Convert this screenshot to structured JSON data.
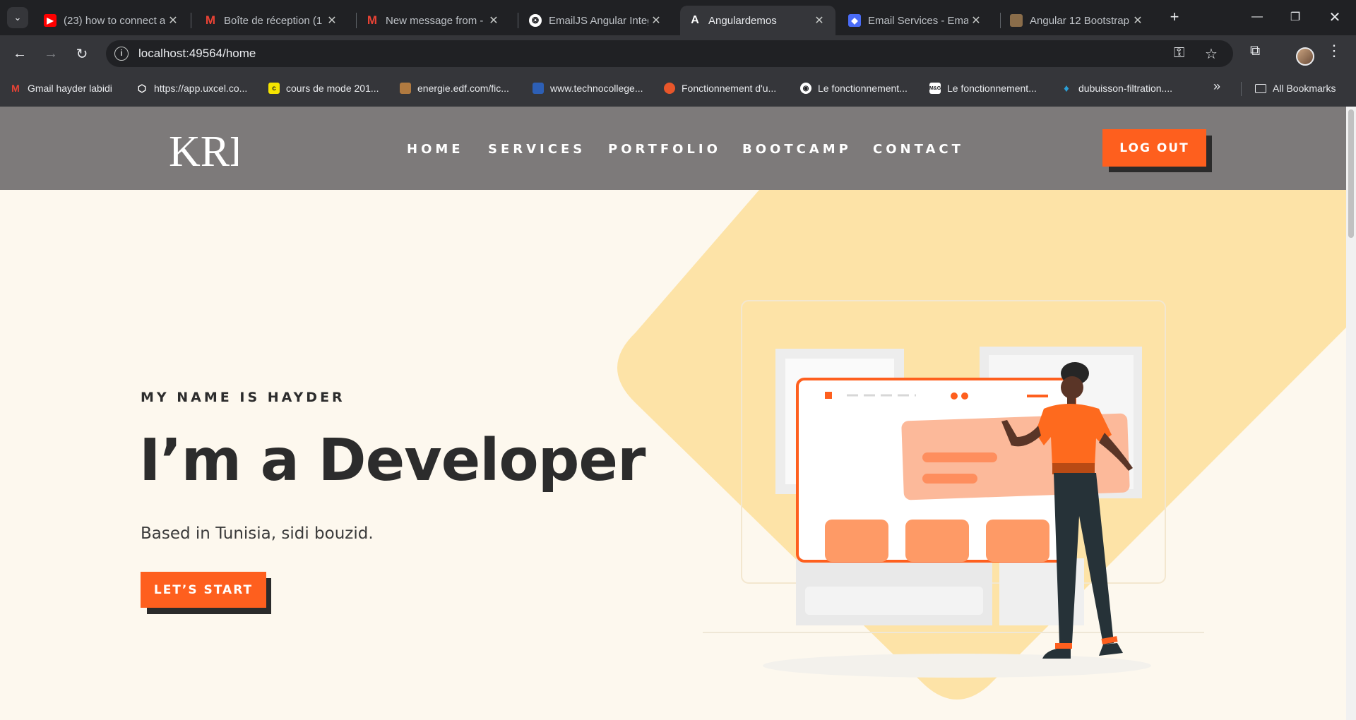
{
  "browser": {
    "tabs": [
      {
        "title": "(23) how to connect a",
        "favicon": "youtube-icon",
        "color": "#ff0000"
      },
      {
        "title": "Boîte de réception (1",
        "favicon": "gmail-icon",
        "color": "#ea4335"
      },
      {
        "title": "New message from -",
        "favicon": "gmail-icon",
        "color": "#ea4335"
      },
      {
        "title": "EmailJS Angular Integ",
        "favicon": "chatgpt-icon",
        "color": "#ffffff"
      },
      {
        "title": "Angulardemos",
        "favicon": "angular-icon",
        "color": "#ffffff",
        "active": true
      },
      {
        "title": "Email Services - Emai",
        "favicon": "emailjs-icon",
        "color": "#4a6cf7"
      },
      {
        "title": "Angular 12 Bootstrap",
        "favicon": "image-icon",
        "color": "#8a6d4a"
      }
    ],
    "url": "localhost:49564/home",
    "bookmarks": [
      {
        "label": "Gmail hayder labidi",
        "favicon": "gmail-icon",
        "color": "#ea4335"
      },
      {
        "label": "https://app.uxcel.co...",
        "favicon": "uxcel-icon",
        "color": "#ffffff"
      },
      {
        "label": "cours de mode 201...",
        "favicon": "coursera-icon",
        "color": "#f5e400"
      },
      {
        "label": "energie.edf.com/fic...",
        "favicon": "edf-icon",
        "color": "#b07a40"
      },
      {
        "label": "www.technocollege...",
        "favicon": "techno-icon",
        "color": "#2d5fb5"
      },
      {
        "label": "Fonctionnement d'u...",
        "favicon": "page-icon",
        "color": "#e8562a"
      },
      {
        "label": "Le fonctionnement...",
        "favicon": "radio-icon",
        "color": "#ffffff"
      },
      {
        "label": "Le fonctionnement...",
        "favicon": "mg-icon",
        "color": "#ffffff"
      },
      {
        "label": "dubuisson-filtration....",
        "favicon": "drop-icon",
        "color": "#2a9fd6"
      }
    ],
    "all_bookmarks_label": "All Bookmarks"
  },
  "site": {
    "logo_text": "KRD",
    "nav": [
      "HOME",
      "SERVICES",
      "PORTFOLIO",
      "BOOTCAMP",
      "CONTACT"
    ],
    "logout_label": "LOG OUT",
    "hero": {
      "eyebrow": "MY NAME IS HAYDER",
      "headline": "I’m a Developer",
      "subline": "Based in Tunisia, sidi bouzid.",
      "cta_label": "LET’S START"
    },
    "colors": {
      "accent": "#fe5f1e",
      "navbar": "#7d7a7a",
      "background": "#fdf8ee",
      "blob": "#fde3a7"
    }
  }
}
